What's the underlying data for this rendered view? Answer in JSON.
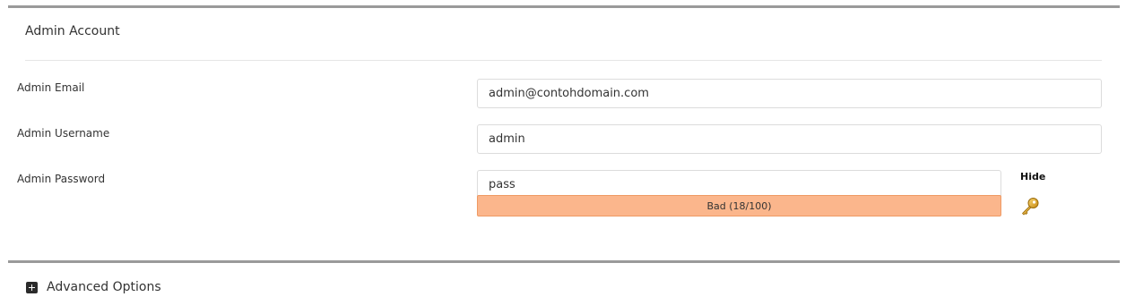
{
  "admin_account": {
    "title": "Admin Account",
    "email": {
      "label": "Admin Email",
      "value": "admin@contohdomain.com"
    },
    "username": {
      "label": "Admin Username",
      "value": "admin"
    },
    "password": {
      "label": "Admin Password",
      "value": "pass",
      "toggle_label": "Hide",
      "strength_text": "Bad (18/100)",
      "strength_score": 18,
      "strength_max": 100,
      "strength_color": "#fbb68c",
      "generate_icon": "key-icon"
    }
  },
  "advanced_options": {
    "label": "Advanced Options",
    "toggle_icon": "plus-square-icon"
  }
}
